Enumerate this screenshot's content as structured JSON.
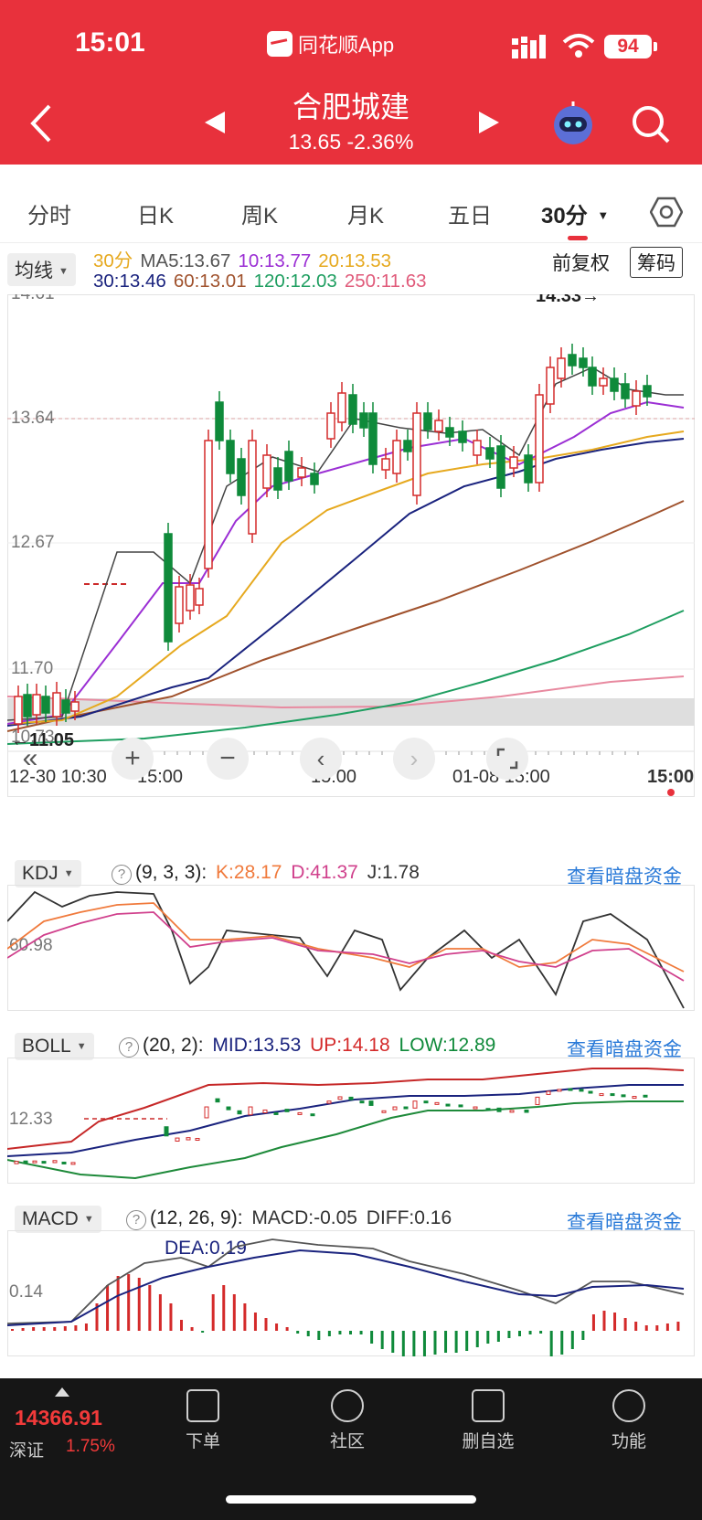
{
  "status": {
    "time": "15:01",
    "app_name": "同花顺App",
    "battery": "94"
  },
  "stock": {
    "name": "合肥城建",
    "quote": "13.65 -2.36%"
  },
  "tabs": [
    {
      "label": "分时"
    },
    {
      "label": "日K"
    },
    {
      "label": "周K"
    },
    {
      "label": "月K"
    },
    {
      "label": "五日"
    },
    {
      "label": "30分",
      "active": true
    }
  ],
  "ma_panel": {
    "selector": "均线",
    "period": "30分",
    "items_row1": [
      {
        "text": "MA5:13.67",
        "color": "#555555"
      },
      {
        "text": "10:13.77",
        "color": "#9b2fd4"
      },
      {
        "text": "20:13.53",
        "color": "#e6a91f"
      }
    ],
    "items_row2": [
      {
        "text": "30:13.46",
        "color": "#1a237e"
      },
      {
        "text": "60:13.01",
        "color": "#a0522d"
      },
      {
        "text": "120:12.03",
        "color": "#1e9e60"
      },
      {
        "text": "250:11.63",
        "color": "#e05a7a"
      }
    ],
    "restore": "前复权",
    "chips": "筹码"
  },
  "price_chart": {
    "y_labels": [
      "14.61",
      "13.64",
      "12.67",
      "11.70",
      "10.73"
    ],
    "high_marker": "14.33→",
    "low_marker": "←11.05",
    "x_labels": [
      "12-30 10:30",
      "15:00",
      "15:00",
      "01-08 15:00",
      "15:00"
    ]
  },
  "kdj": {
    "name": "KDJ",
    "params": "(9, 3, 3):",
    "k": "K:28.17",
    "d": "D:41.37",
    "j": "J:1.78",
    "level_label": "60.98",
    "link": "查看暗盘资金"
  },
  "boll": {
    "name": "BOLL",
    "params": "(20, 2):",
    "mid": "MID:13.53",
    "up": "UP:14.18",
    "low": "LOW:12.89",
    "level_label": "12.33",
    "link": "查看暗盘资金"
  },
  "macd": {
    "name": "MACD",
    "params": "(12, 26, 9):",
    "macd": "MACD:-0.05",
    "diff": "DIFF:0.16",
    "dea": "DEA:0.19",
    "level_label": "0.14",
    "link": "查看暗盘资金"
  },
  "bottom": {
    "index_value": "14366.91",
    "index_name": "深证",
    "index_change": "1.75%",
    "nav": [
      {
        "label": "下单"
      },
      {
        "label": "社区"
      },
      {
        "label": "删自选"
      },
      {
        "label": "功能"
      }
    ]
  },
  "colors": {
    "up": "#d42a2a",
    "down": "#0f8a3a",
    "brand": "#e8313c",
    "link": "#2a7ad8"
  }
}
